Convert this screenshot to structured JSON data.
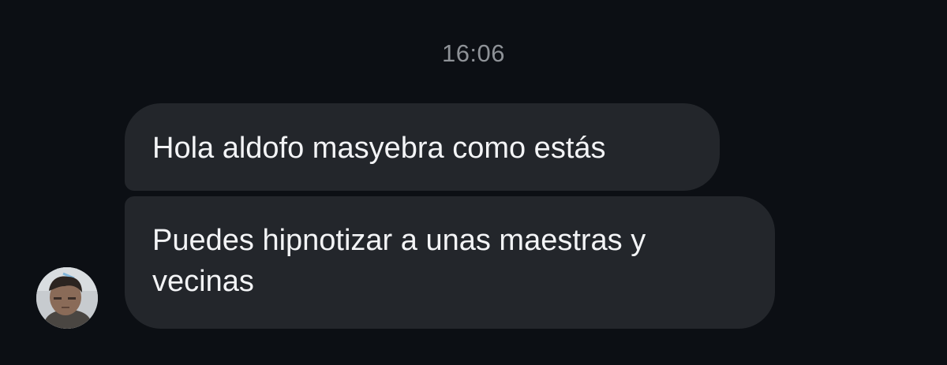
{
  "conversation": {
    "timestamp": "16:06",
    "messages": [
      {
        "text": "Hola aldofo masyebra como estás"
      },
      {
        "text": "Puedes hipnotizar a unas maestras y vecinas"
      }
    ]
  },
  "avatar": {
    "icon": "contact-photo"
  },
  "colors": {
    "background": "#0c0f14",
    "bubble": "#23262b",
    "message_text": "#f3f4f6",
    "timestamp_text": "#8e9297"
  }
}
